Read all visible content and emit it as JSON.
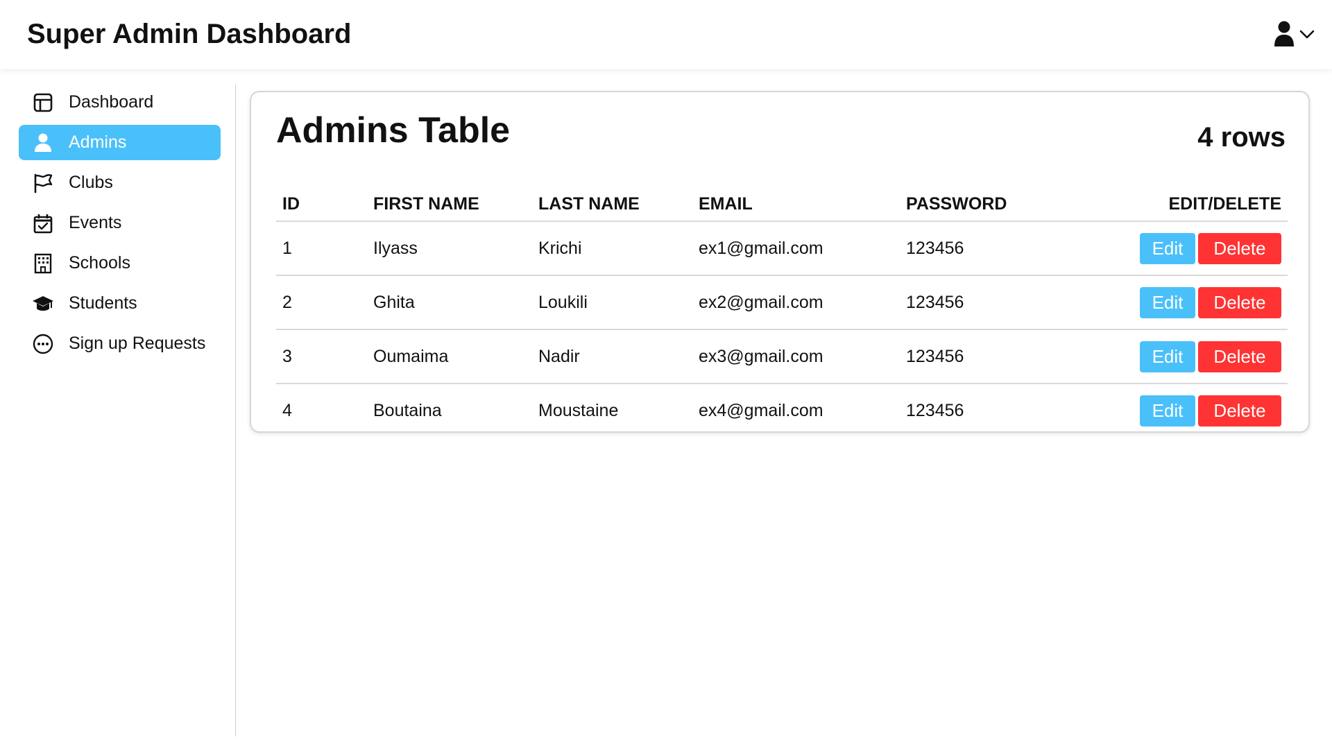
{
  "header": {
    "title": "Super Admin Dashboard",
    "user_icon": "user-icon",
    "dropdown_icon": "chevron-down-icon"
  },
  "sidebar": {
    "items": [
      {
        "label": "Dashboard",
        "icon": "dashboard-icon",
        "active": false
      },
      {
        "label": "Admins",
        "icon": "user-icon",
        "active": true
      },
      {
        "label": "Clubs",
        "icon": "flag-icon",
        "active": false
      },
      {
        "label": "Events",
        "icon": "calendar-check-icon",
        "active": false
      },
      {
        "label": "Schools",
        "icon": "building-icon",
        "active": false
      },
      {
        "label": "Students",
        "icon": "graduation-cap-icon",
        "active": false
      },
      {
        "label": "Sign up Requests",
        "icon": "more-circle-icon",
        "active": false
      }
    ]
  },
  "main": {
    "title": "Admins Table",
    "row_count": "4 rows",
    "table": {
      "headers": [
        "ID",
        "FIRST NAME",
        "LAST NAME",
        "EMAIL",
        "PASSWORD",
        "EDIT/DELETE"
      ],
      "rows": [
        {
          "id": "1",
          "first_name": "Ilyass",
          "last_name": "Krichi",
          "email": "ex1@gmail.com",
          "password": "123456"
        },
        {
          "id": "2",
          "first_name": "Ghita",
          "last_name": "Loukili",
          "email": "ex2@gmail.com",
          "password": "123456"
        },
        {
          "id": "3",
          "first_name": "Oumaima",
          "last_name": "Nadir",
          "email": "ex3@gmail.com",
          "password": "123456"
        },
        {
          "id": "4",
          "first_name": "Boutaina",
          "last_name": "Moustaine",
          "email": "ex4@gmail.com",
          "password": "123456"
        }
      ],
      "edit_label": "Edit",
      "delete_label": "Delete"
    }
  },
  "colors": {
    "accent": "#4ac0fa",
    "danger": "#ff3333",
    "text": "#111111",
    "border": "#d9d9d9"
  }
}
